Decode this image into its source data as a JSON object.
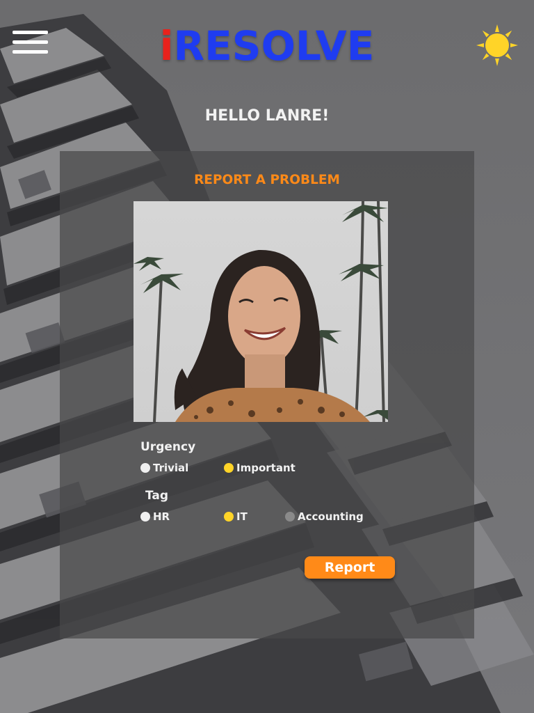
{
  "app": {
    "logo_first": "i",
    "logo_rest": "RESOLVE",
    "brand_colors": {
      "logo_first": "#e8221c",
      "logo_rest": "#1f3cf0",
      "accent": "#ff8a18",
      "selected_radio": "#ffd428"
    }
  },
  "header": {
    "menu_icon": "hamburger-menu-icon",
    "theme_icon": "sun-icon"
  },
  "greeting": "HELLO LANRE!",
  "form": {
    "title": "REPORT A PROBLEM",
    "urgency": {
      "label": "Urgency",
      "options": [
        {
          "label": "Trivial",
          "state": "unselected"
        },
        {
          "label": "Important",
          "state": "selected"
        }
      ]
    },
    "tag": {
      "label": "Tag",
      "options": [
        {
          "label": "HR",
          "state": "unselected"
        },
        {
          "label": "IT",
          "state": "selected"
        },
        {
          "label": "Accounting",
          "state": "disabled"
        }
      ]
    },
    "submit_label": "Report"
  }
}
